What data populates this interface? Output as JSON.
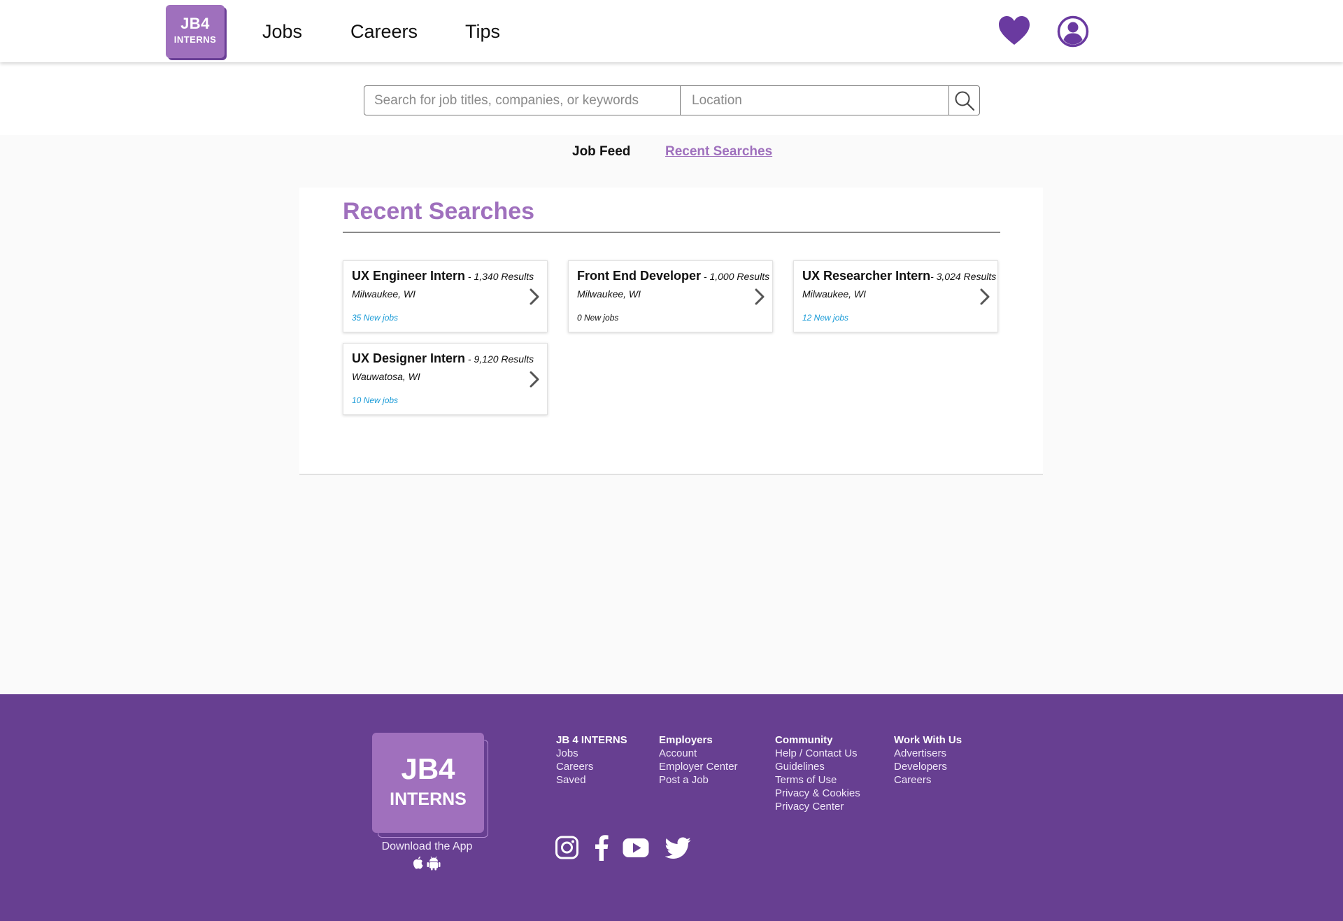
{
  "header": {
    "logo": {
      "line1": "JB4",
      "line2": "INTERNS"
    },
    "nav": {
      "jobs": "Jobs",
      "careers": "Careers",
      "tips": "Tips"
    },
    "icons": {
      "favorites": "heart-icon",
      "profile": "user-circle-icon"
    }
  },
  "search": {
    "keywords_placeholder": "Search for job titles, companies, or keywords",
    "location_placeholder": "Location",
    "button_icon": "search-icon"
  },
  "tabs": {
    "feed": "Job Feed",
    "recent": "Recent Searches"
  },
  "recent": {
    "title": "Recent Searches",
    "cards": [
      {
        "title": "UX Engineer Intern",
        "results": " - 1,340 Results",
        "location": "Milwaukee, WI",
        "new_jobs": "35 New jobs",
        "new_color": "#1a9bd7"
      },
      {
        "title": "Front End Developer",
        "results": " - 1,000 Results",
        "location": "Milwaukee, WI",
        "new_jobs": "0 New jobs",
        "new_color": "#111111"
      },
      {
        "title": "UX Researcher Intern",
        "results": "- 3,024 Results",
        "location": "Milwaukee, WI",
        "new_jobs": "12 New jobs",
        "new_color": "#1a9bd7"
      },
      {
        "title": "UX Designer Intern",
        "results": " - 9,120 Results",
        "location": "Wauwatosa, WI",
        "new_jobs": "10 New jobs",
        "new_color": "#1a9bd7"
      }
    ]
  },
  "footer": {
    "logo": {
      "line1": "JB4",
      "line2": "INTERNS"
    },
    "download": "Download the App",
    "columns": [
      {
        "heading": "JB 4 INTERNS",
        "links": [
          "Jobs",
          "Careers",
          "Saved"
        ]
      },
      {
        "heading": "Employers",
        "links": [
          "Account",
          "Employer Center",
          "Post a Job"
        ]
      },
      {
        "heading": "Community",
        "links": [
          "Help / Contact Us",
          "Guidelines",
          "Terms of Use",
          "Privacy & Cookies",
          "Privacy Center"
        ]
      },
      {
        "heading": "Work With Us",
        "links": [
          "Advertisers",
          "Developers",
          "Careers"
        ]
      }
    ],
    "social": [
      "instagram-icon",
      "facebook-icon",
      "youtube-icon",
      "twitter-icon"
    ]
  },
  "colors": {
    "brand_purple": "#9f70bd",
    "footer_purple": "#673f91",
    "heart_purple": "#6a3aa0",
    "new_jobs_blue": "#1a9bd7"
  }
}
